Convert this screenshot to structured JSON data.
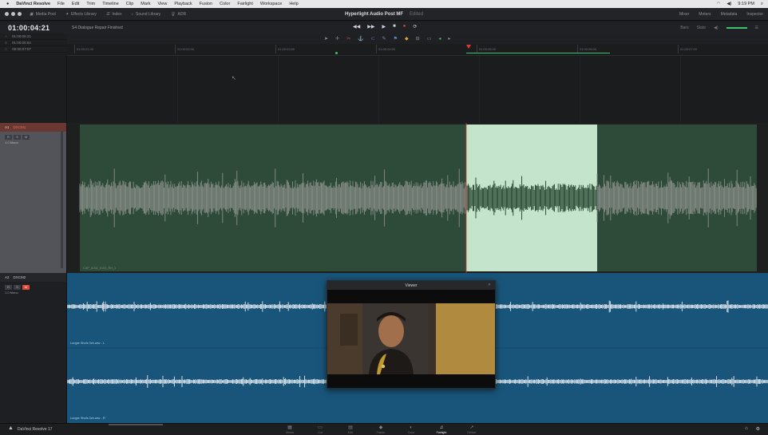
{
  "menubar": {
    "app_name": "DaVinci Resolve",
    "items": [
      "File",
      "Edit",
      "Trim",
      "Timeline",
      "Clip",
      "Mark",
      "View",
      "Playback",
      "Fusion",
      "Color",
      "Fairlight",
      "Workspace",
      "Help"
    ],
    "clock": "9:19 PM"
  },
  "toolbar": {
    "left_items": [
      "Media Pool",
      "Effects Library",
      "Index",
      "Sound Library",
      "ADR"
    ],
    "project_name": "Hyperlight Audio Post MF",
    "project_status": "Edited",
    "right_items": [
      "Mixer",
      "Meters",
      "Metadata",
      "Inspector"
    ]
  },
  "timecode": {
    "current": "01:00:04:21",
    "timeline_name": "S4 Dialogue Repair Finished",
    "info_rows": [
      {
        "label": "A",
        "value": "01:00:00:21"
      },
      {
        "label": "B",
        "value": "01:00:00:04"
      },
      {
        "label": "C",
        "value": "00:00:07:07"
      }
    ],
    "right_items": [
      "Bars",
      "Slate"
    ]
  },
  "ruler": {
    "ticks": [
      "01:00:01:00",
      "01:00:02:00",
      "01:00:03:00",
      "01:00:04:00",
      "01:00:05:00",
      "01:00:06:00",
      "01:00:07:00"
    ]
  },
  "tracks": [
    {
      "id": "A1",
      "name": "DXCM1",
      "format": "1.0  Mono",
      "buttons": [
        "R",
        "S",
        "M"
      ],
      "color": "#2e4a38"
    },
    {
      "id": "A2",
      "name": "DXCM2",
      "format": "1.0  Mono",
      "buttons": [
        "R",
        "S",
        "M"
      ],
      "color": "#19557a"
    }
  ],
  "clips": {
    "a1_label": "CAP_A002_0102_RH_1",
    "a2_label_top": "Longer Shots 3ch.wav - L",
    "a2_label_bottom": "Longer Shots 3ch.wav - R"
  },
  "viewer": {
    "title": "Viewer"
  },
  "pages": [
    {
      "name": "Media",
      "icon": "▦"
    },
    {
      "name": "Cut",
      "icon": "▭"
    },
    {
      "name": "Edit",
      "icon": "▤"
    },
    {
      "name": "Fusion",
      "icon": "◆"
    },
    {
      "name": "Color",
      "icon": "◐"
    },
    {
      "name": "Fairlight",
      "icon": "♫"
    },
    {
      "name": "Deliver",
      "icon": "➚"
    }
  ],
  "active_page": "Fairlight",
  "brand_label": "DaVinci Resolve 17",
  "colors": {
    "a1_clip": "#2e4a38",
    "a1_selection": "#c4e5cc",
    "a2_clip": "#19557a",
    "playhead": "#e33a2e",
    "record": "#e04a3a"
  }
}
